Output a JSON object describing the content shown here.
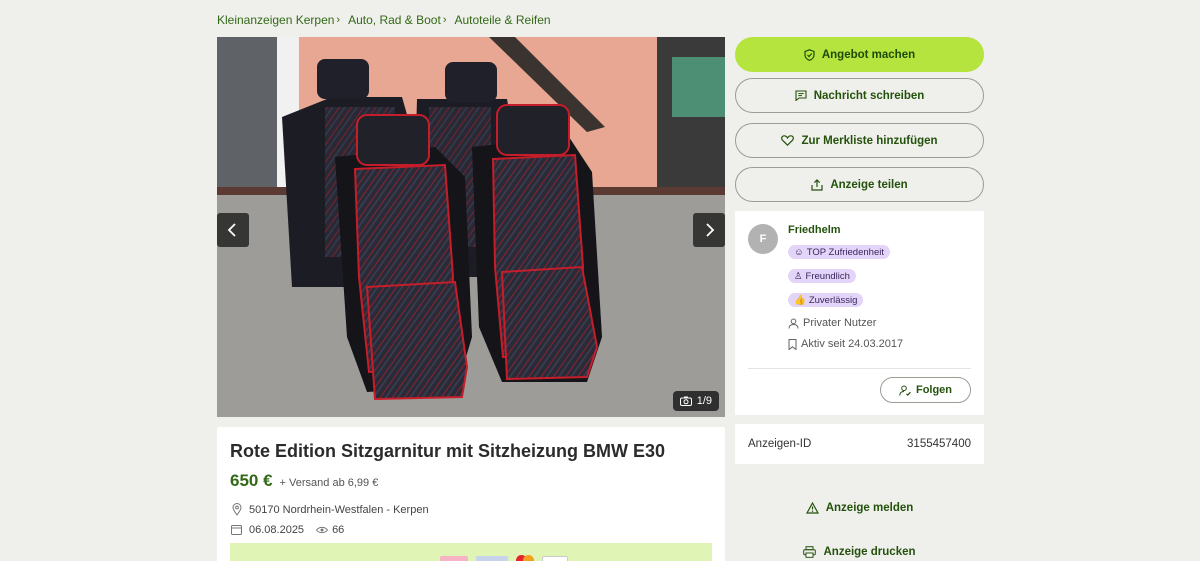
{
  "breadcrumb": [
    {
      "label": "Kleinanzeigen Kerpen"
    },
    {
      "label": "Auto, Rad & Boot"
    },
    {
      "label": "Autoteile & Reifen"
    }
  ],
  "gallery": {
    "counter": "1/9"
  },
  "listing": {
    "title": "Rote Edition Sitzgarnitur mit Sitzheizung BMW E30",
    "price": "650 €",
    "shipping": "+ Versand ab 6,99 €",
    "location": "50170 Nordrhein-Westfalen - Kerpen",
    "date": "06.08.2025",
    "views": "66"
  },
  "actions": {
    "offer": "Angebot machen",
    "message": "Nachricht schreiben",
    "favorite": "Zur Merkliste hinzufügen",
    "share": "Anzeige teilen"
  },
  "seller": {
    "initial": "F",
    "name": "Friedhelm",
    "badges": [
      "TOP Zufriedenheit",
      "Freundlich",
      "Zuverlässig"
    ],
    "type": "Privater Nutzer",
    "active_since": "Aktiv seit 24.03.2017",
    "follow": "Folgen"
  },
  "ad_id": {
    "label": "Anzeigen-ID",
    "value": "3155457400"
  },
  "links": {
    "report": "Anzeige melden",
    "print": "Anzeige drucken"
  },
  "colors": {
    "accent": "#b4e43d",
    "brand_text": "#326916",
    "badge_bg": "#e3d5f7"
  }
}
